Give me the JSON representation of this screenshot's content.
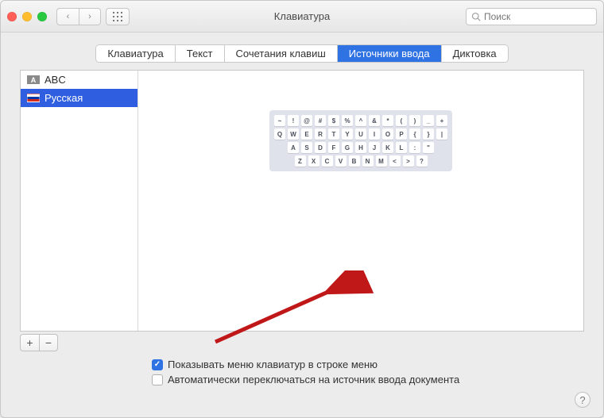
{
  "window_title": "Клавиатура",
  "search": {
    "placeholder": "Поиск"
  },
  "tabs": [
    {
      "label": "Клавиатура",
      "active": false
    },
    {
      "label": "Текст",
      "active": false
    },
    {
      "label": "Сочетания клавиш",
      "active": false
    },
    {
      "label": "Источники ввода",
      "active": true
    },
    {
      "label": "Диктовка",
      "active": false
    }
  ],
  "sources": [
    {
      "label": "ABC",
      "flag": "abc",
      "selected": false
    },
    {
      "label": "Русская",
      "flag": "ru",
      "selected": true
    }
  ],
  "keyboard_rows": [
    [
      "~",
      "!",
      "@",
      "#",
      "$",
      "%",
      "^",
      "&",
      "*",
      "(",
      ")",
      "_",
      "+"
    ],
    [
      "Q",
      "W",
      "E",
      "R",
      "T",
      "Y",
      "U",
      "I",
      "O",
      "P",
      "{",
      "}",
      "|"
    ],
    [
      "A",
      "S",
      "D",
      "F",
      "G",
      "H",
      "J",
      "K",
      "L",
      ":",
      "\""
    ],
    [
      "Z",
      "X",
      "C",
      "V",
      "B",
      "N",
      "M",
      "<",
      ">",
      "?"
    ]
  ],
  "buttons": {
    "add": "+",
    "remove": "−"
  },
  "checkboxes": [
    {
      "label": "Показывать меню клавиатур в строке меню",
      "checked": true
    },
    {
      "label": "Автоматически переключаться на источник ввода документа",
      "checked": false
    }
  ],
  "help": "?"
}
